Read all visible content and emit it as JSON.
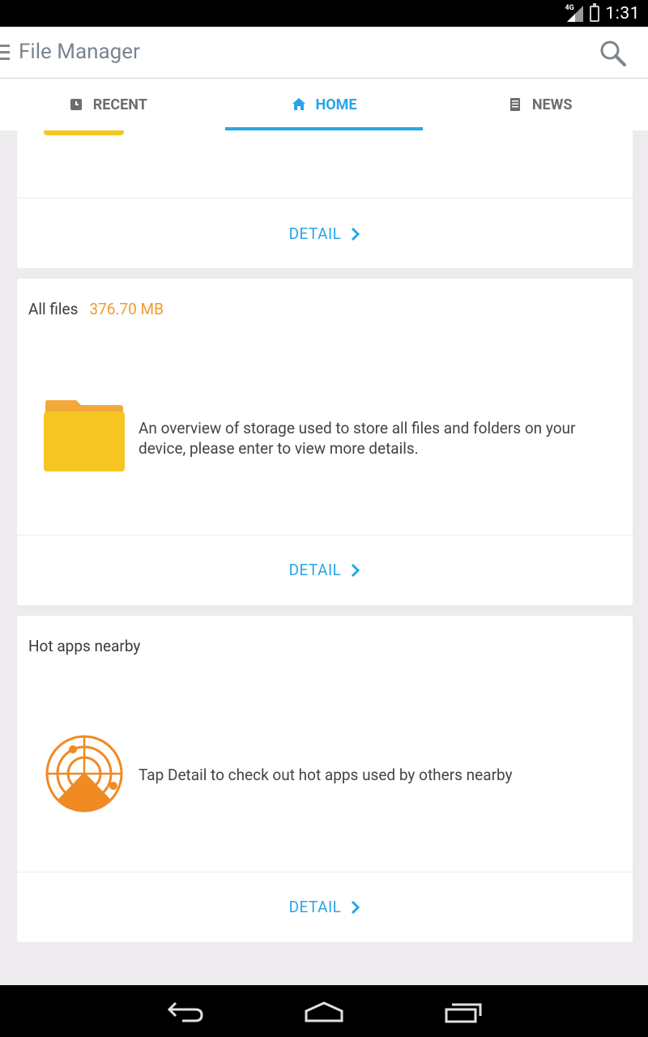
{
  "status_bar": {
    "network": "4G",
    "time": "1:31"
  },
  "app_bar": {
    "title": "File Manager"
  },
  "tabs": [
    {
      "label": "RECENT",
      "icon": "recent-icon"
    },
    {
      "label": "HOME",
      "icon": "home-icon",
      "active": true
    },
    {
      "label": "NEWS",
      "icon": "news-icon"
    }
  ],
  "cards": {
    "top": {
      "detail_label": "DETAIL"
    },
    "all_files": {
      "title": "All files",
      "size": "376.70 MB",
      "description": "An overview of storage used to store all files and folders on your device, please enter to view more details.",
      "detail_label": "DETAIL"
    },
    "hot_apps": {
      "title": "Hot apps nearby",
      "description": "Tap Detail to check out hot apps used by others nearby",
      "detail_label": "DETAIL"
    }
  },
  "colors": {
    "accent": "#29a5e6",
    "size_orange": "#f19a30",
    "folder_yellow": "#f5c623",
    "radar_orange": "#f08a22"
  }
}
